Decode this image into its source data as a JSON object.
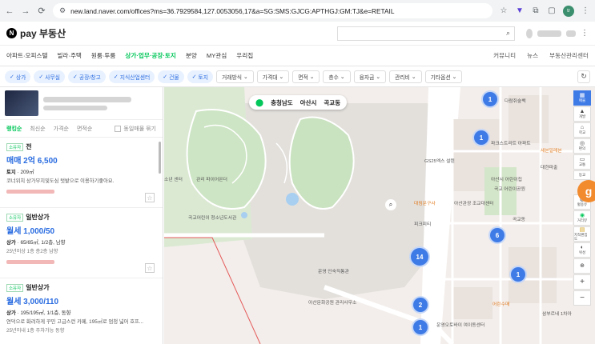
{
  "browser": {
    "url": "new.land.naver.com/offices?ms=36.7929584,127.0053056,17&a=SG:SMS:GJCG:APTHGJ:GM:TJ&e=RETAIL",
    "profile": "tr"
  },
  "header": {
    "logo_text": "pay 부동산"
  },
  "nav": {
    "items": [
      "아파트·오피스텔",
      "빌라·주택",
      "원룸·투룸",
      "상가·업무·공장·토지",
      "분양",
      "MY관심",
      "우리집"
    ],
    "right_items": [
      "커뮤니티",
      "뉴스",
      "부동산관리센터"
    ]
  },
  "filters": {
    "chips": [
      "상가",
      "사무실",
      "공장/창고",
      "지식산업센터",
      "건물",
      "토지"
    ],
    "dropdowns": [
      "거래방식",
      "가격대",
      "면적",
      "층수",
      "융자금",
      "관리비",
      "기타옵션"
    ]
  },
  "list": {
    "sorts": [
      "랭킹순",
      "최신순",
      "가격순",
      "면적순"
    ],
    "same_listing": "동일매물 묶기",
    "items": [
      {
        "badge": "소유자",
        "type": "전",
        "price": "매매 2억 6,500",
        "detail_label": "토지",
        "detail": " · 209㎡",
        "desc": "코너위치 상가부지및도심 텃밭으로 이용하기좋아요.",
        "tags": ""
      },
      {
        "badge": "소유자",
        "type": "일반상가",
        "price": "월세 1,000/50",
        "detail_label": "상가",
        "detail": " · 65/65㎡, 1/2층, 남향",
        "desc": "",
        "tags": "25년이상   1층   층2층   남향"
      },
      {
        "badge": "소유자",
        "type": "일반상가",
        "price": "월세 3,000/110",
        "detail_label": "상가",
        "detail": " · 195/195㎡, 1/1층, 동향",
        "desc": "연덕으로 화려하게 꾸민 고급스런 카페, 195㎡로 엄청 넓어 호프...",
        "tags": "25년이내   1층   주차가능   동향"
      }
    ]
  },
  "map": {
    "region": [
      "충청남도",
      "아산시",
      "곡교동"
    ],
    "clusters": [
      "1",
      "1",
      "6",
      "14",
      "1",
      "2",
      "1"
    ],
    "labels": [
      "다람쥐숲백",
      "파크스트리트 아파트",
      "세븐일레븐",
      "대한파출",
      "GS25엑스 설텐",
      "아산시 어린이집",
      "대림문구사",
      "아산관광 조교대센터",
      "곡교 어린이공원",
      "곡교동",
      "관리 파이어몬더",
      "곡교어린이 청소년도서관",
      "소년 센터",
      "피크피티",
      "운영 인숙직통관",
      "아산문화공원 관리사무소",
      "운영오토바이 여이동센터",
      "어린수매",
      "삼부르네 1차아"
    ],
    "tools": [
      "매물",
      "개발",
      "학교",
      "편의",
      "교통",
      "등교",
      "혈용유",
      "거리뷰",
      "지적편집도",
      "위성",
      "측정"
    ]
  }
}
